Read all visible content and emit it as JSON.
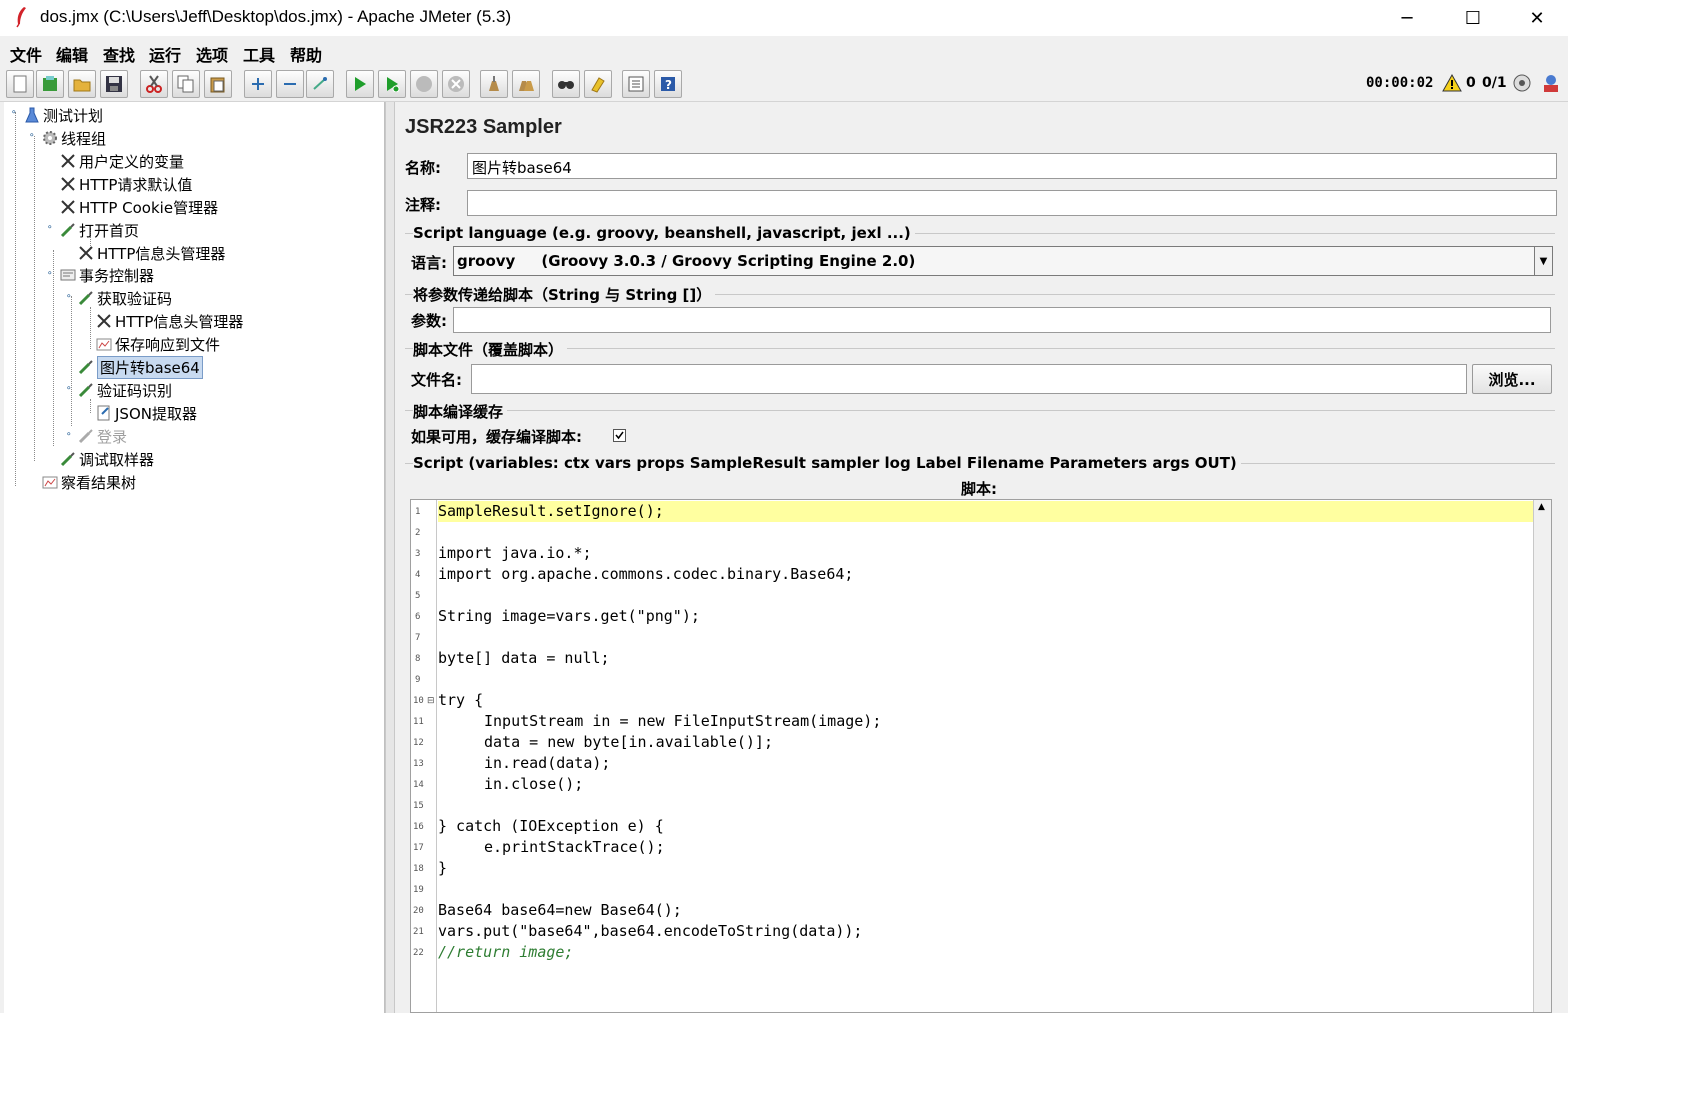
{
  "window": {
    "title": "dos.jmx (C:\\Users\\Jeff\\Desktop\\dos.jmx) - Apache JMeter (5.3)",
    "minimize": "─",
    "maximize": "☐",
    "close": "✕"
  },
  "menu": [
    "文件",
    "编辑",
    "查找",
    "运行",
    "选项",
    "工具",
    "帮助"
  ],
  "toolbar": {
    "buttons": [
      "new-icon",
      "templates-icon",
      "open-icon",
      "save-icon",
      "cut-icon",
      "copy-icon",
      "paste-icon",
      "expand-icon",
      "collapse-icon",
      "toggle-icon",
      "start-icon",
      "start-no-pause-icon",
      "stop-icon",
      "shutdown-icon",
      "clear-icon",
      "clear-all-icon",
      "search-icon",
      "reset-search-icon",
      "function-helper-icon",
      "help-icon"
    ],
    "elapsed": "00:00:02",
    "warnings": "0",
    "threads": "0/1"
  },
  "tree": [
    {
      "label": "测试计划",
      "icon": "flask-icon"
    },
    {
      "label": "线程组",
      "icon": "gear-icon"
    },
    {
      "label": "用户定义的变量",
      "icon": "wrench-icon"
    },
    {
      "label": "HTTP请求默认值",
      "icon": "wrench-icon"
    },
    {
      "label": "HTTP Cookie管理器",
      "icon": "wrench-icon"
    },
    {
      "label": "打开首页",
      "icon": "pipette-icon"
    },
    {
      "label": "HTTP信息头管理器",
      "icon": "wrench-icon"
    },
    {
      "label": "事务控制器",
      "icon": "controller-icon"
    },
    {
      "label": "获取验证码",
      "icon": "pipette-icon"
    },
    {
      "label": "HTTP信息头管理器",
      "icon": "wrench-icon"
    },
    {
      "label": "保存响应到文件",
      "icon": "listener-icon"
    },
    {
      "label": "图片转base64",
      "icon": "pipette-icon"
    },
    {
      "label": "验证码识别",
      "icon": "pipette-icon"
    },
    {
      "label": "JSON提取器",
      "icon": "extractor-icon"
    },
    {
      "label": "登录",
      "icon": "pipette-icon"
    },
    {
      "label": "调试取样器",
      "icon": "pipette-icon"
    },
    {
      "label": "察看结果树",
      "icon": "listener-icon"
    }
  ],
  "panel": {
    "title": "JSR223 Sampler",
    "name_label": "名称:",
    "name_value": "图片转base64",
    "comment_label": "注释:",
    "comment_value": "",
    "script_language_section": "Script language (e.g. groovy, beanshell, javascript, jexl ...)",
    "language_label": "语言:",
    "language_value": "groovy     (Groovy 3.0.3 / Groovy Scripting Engine 2.0)",
    "params_section": "将参数传递给脚本（String 与 String []）",
    "params_label": "参数:",
    "params_value": "",
    "file_section": "脚本文件（覆盖脚本）",
    "file_label": "文件名:",
    "file_value": "",
    "browse_label": "浏览...",
    "cache_section": "脚本编译缓存",
    "cache_label": "如果可用，缓存编译脚本:",
    "cache_checked": true,
    "script_section": "Script (variables: ctx vars props SampleResult sampler log Label Filename Parameters args OUT)",
    "script_label": "脚本:"
  },
  "code_lines": [
    "1",
    "2",
    "3",
    "4",
    "5",
    "6",
    "7",
    "8",
    "9",
    "10",
    "11",
    "12",
    "13",
    "14",
    "15",
    "16",
    "17",
    "18",
    "19",
    "20",
    "21",
    "22"
  ],
  "code_text": {
    "l1": "SampleResult.setIgnore();",
    "l3": "import java.io.*;",
    "l4": "import org.apache.commons.codec.binary.Base64;",
    "l6": "String image=vars.get(\"png\");",
    "l8": "byte[] data = null;",
    "l10": "try {",
    "l11": "InputStream in = new FileInputStream(image);",
    "l12": "data = new byte[in.available()];",
    "l13": "in.read(data);",
    "l14": "in.close();",
    "l16": "} catch (IOException e) {",
    "l17": "e.printStackTrace();",
    "l18": "}",
    "l20": "Base64 base64=new Base64();",
    "l21": "vars.put(\"base64\",base64.encodeToString(data));",
    "l22": "//return image;"
  }
}
